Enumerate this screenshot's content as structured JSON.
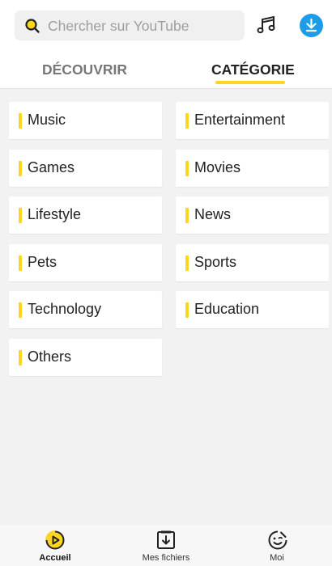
{
  "search": {
    "placeholder": "Chercher sur YouTube",
    "icon": "search-icon"
  },
  "header": {
    "music_icon": "music-note-icon",
    "download_icon": "download-icon"
  },
  "tabs": [
    {
      "label": "DÉCOUVRIR",
      "active": false
    },
    {
      "label": "CATÉGORIE",
      "active": true
    }
  ],
  "categories": [
    {
      "label": "Music"
    },
    {
      "label": "Entertainment"
    },
    {
      "label": "Games"
    },
    {
      "label": "Movies"
    },
    {
      "label": "Lifestyle"
    },
    {
      "label": "News"
    },
    {
      "label": "Pets"
    },
    {
      "label": "Sports"
    },
    {
      "label": "Technology"
    },
    {
      "label": "Education"
    },
    {
      "label": "Others"
    }
  ],
  "bottom_nav": [
    {
      "label": "Accueil",
      "icon": "home-play-icon",
      "active": true
    },
    {
      "label": "Mes fichiers",
      "icon": "files-download-icon",
      "active": false
    },
    {
      "label": "Moi",
      "icon": "smiley-icon",
      "active": false
    }
  ],
  "colors": {
    "accent": "#ffd51f",
    "download_button": "#1e9be9",
    "background": "#f2f2f2"
  }
}
